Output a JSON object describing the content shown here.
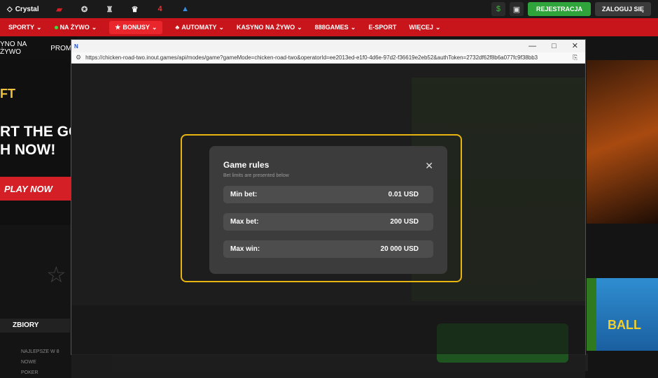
{
  "site": {
    "brand": "Crystal",
    "logos": [
      "league-logo-1",
      "champions-league-logo",
      "europa-league-logo",
      "premier-league-logo",
      "laliga-logo",
      "serie-a-logo"
    ],
    "register_label": "REJESTRACJA",
    "login_label": "ZALOGUJ SIĘ",
    "nav": [
      {
        "label": "SPORTY"
      },
      {
        "label": "NA ŻYWO"
      },
      {
        "label": "BONUSY"
      },
      {
        "label": "AUTOMATY"
      },
      {
        "label": "KASYNO NA ŻYWO"
      },
      {
        "label": "888GAMES"
      },
      {
        "label": "E-SPORT"
      },
      {
        "label": "WIĘCEJ"
      }
    ],
    "subnav_left": "YNO NA ŻYWO",
    "subnav_right": "PROMO",
    "banner_line1": "RT THE GO",
    "banner_line2": "H NOW!",
    "banner_brand_partial": "FT",
    "play_now": "PLAY NOW",
    "zbiory_label": "ZBIORY",
    "side_items": [
      "NAJLEPSZE W 8",
      "NOWE",
      "POKER"
    ],
    "ulubione_partial": "ULUBIONE",
    "balloon_partial": "BALL"
  },
  "browser": {
    "url": "https://chicken-road-two.inout.games/api/modes/game?gameMode=chicken-road-two&operatorId=ee2013ed-e1f0-4d6e-97d2-f36619e2eb52&authToken=2732df62f8b6a077fc9f38bb3"
  },
  "modal": {
    "title": "Game rules",
    "subtitle": "Bet limits are presented below",
    "rules": [
      {
        "label": "Min bet:",
        "value": "0.01 USD"
      },
      {
        "label": "Max bet:",
        "value": "200 USD"
      },
      {
        "label": "Max win:",
        "value": "20 000 USD"
      }
    ]
  },
  "colors": {
    "brand_red": "#c8151b",
    "register_green": "#2ea43a",
    "highlight_yellow": "#e8b40f"
  }
}
